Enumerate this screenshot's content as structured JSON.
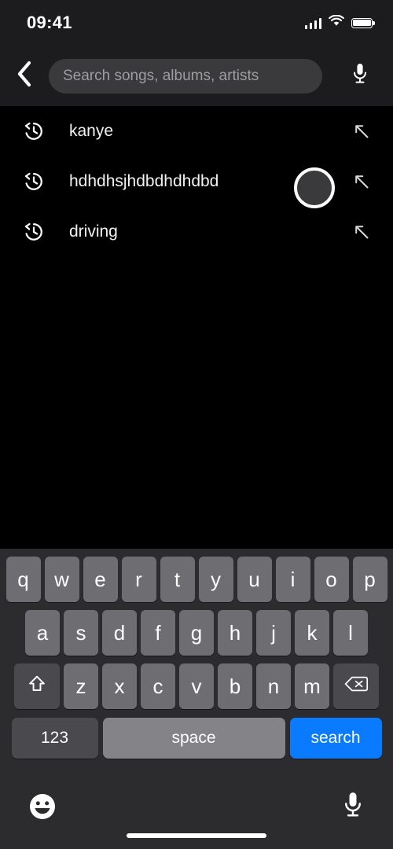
{
  "status_bar": {
    "time": "09:41",
    "cellular_icon": "signal-bars-icon",
    "wifi_icon": "wifi-icon",
    "battery_icon": "battery-full-icon"
  },
  "header": {
    "back_icon": "chevron-left-icon",
    "mic_icon": "microphone-icon",
    "search": {
      "value": "",
      "placeholder": "Search songs, albums, artists"
    }
  },
  "recent_searches": {
    "row_icon": "history-clock-icon",
    "fill_icon": "arrow-up-left-icon",
    "items": [
      {
        "label": "kanye"
      },
      {
        "label": "hdhdhsjhdbdhdhdbd"
      },
      {
        "label": "driving"
      }
    ]
  },
  "touch_indicator": {
    "name": "touch-indicator",
    "ring_color": "#ffffff",
    "fill_color": "#3a3a3c"
  },
  "keyboard": {
    "row1": [
      "q",
      "w",
      "e",
      "r",
      "t",
      "y",
      "u",
      "i",
      "o",
      "p"
    ],
    "row2": [
      "a",
      "s",
      "d",
      "f",
      "g",
      "h",
      "j",
      "k",
      "l"
    ],
    "row3": [
      "z",
      "x",
      "c",
      "v",
      "b",
      "n",
      "m"
    ],
    "shift_icon": "shift-arrow-icon",
    "backspace_icon": "backspace-delete-icon",
    "numbers_label": "123",
    "space_label": "space",
    "search_label": "search",
    "emoji_icon": "emoji-smiley-icon",
    "dictation_icon": "microphone-icon",
    "home_indicator": "home-indicator-bar"
  },
  "colors": {
    "accent_blue": "#0a7aff",
    "key_gray": "#6d6d72",
    "key_special_gray": "#4a4a4e",
    "space_gray": "#838388",
    "keyboard_bg": "#2c2c2e",
    "header_bg": "#1c1c1e",
    "content_bg": "#000000",
    "field_bg": "#3a3a3c",
    "placeholder_gray": "#9d9da2"
  }
}
